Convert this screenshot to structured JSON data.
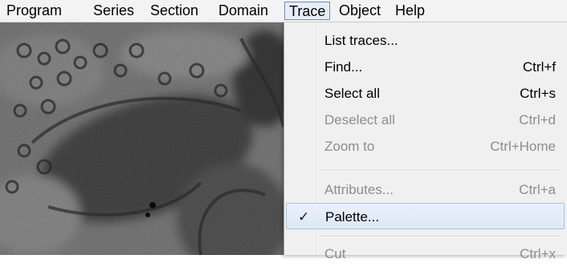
{
  "menubar": {
    "items": [
      "Program",
      "Series",
      "Section",
      "Domain",
      "Trace",
      "Object",
      "Help"
    ],
    "active": "Trace"
  },
  "trace_menu": {
    "items": [
      {
        "label": "List traces...",
        "shortcut": "",
        "enabled": true,
        "checked": false
      },
      {
        "label": "Find...",
        "shortcut": "Ctrl+f",
        "enabled": true,
        "checked": false
      },
      {
        "label": "Select all",
        "shortcut": "Ctrl+s",
        "enabled": true,
        "checked": false
      },
      {
        "label": "Deselect all",
        "shortcut": "Ctrl+d",
        "enabled": false,
        "checked": false
      },
      {
        "label": "Zoom to",
        "shortcut": "Ctrl+Home",
        "enabled": false,
        "checked": false
      },
      {
        "label": "Attributes...",
        "shortcut": "Ctrl+a",
        "enabled": false,
        "checked": false
      },
      {
        "label": "Palette...",
        "shortcut": "",
        "enabled": true,
        "checked": true,
        "highlighted": true
      },
      {
        "label": "Cut",
        "shortcut": "Ctrl+x",
        "enabled": false,
        "checked": false
      }
    ],
    "check_glyph": "✓"
  },
  "icons": {
    "checkmark": "check-icon"
  }
}
